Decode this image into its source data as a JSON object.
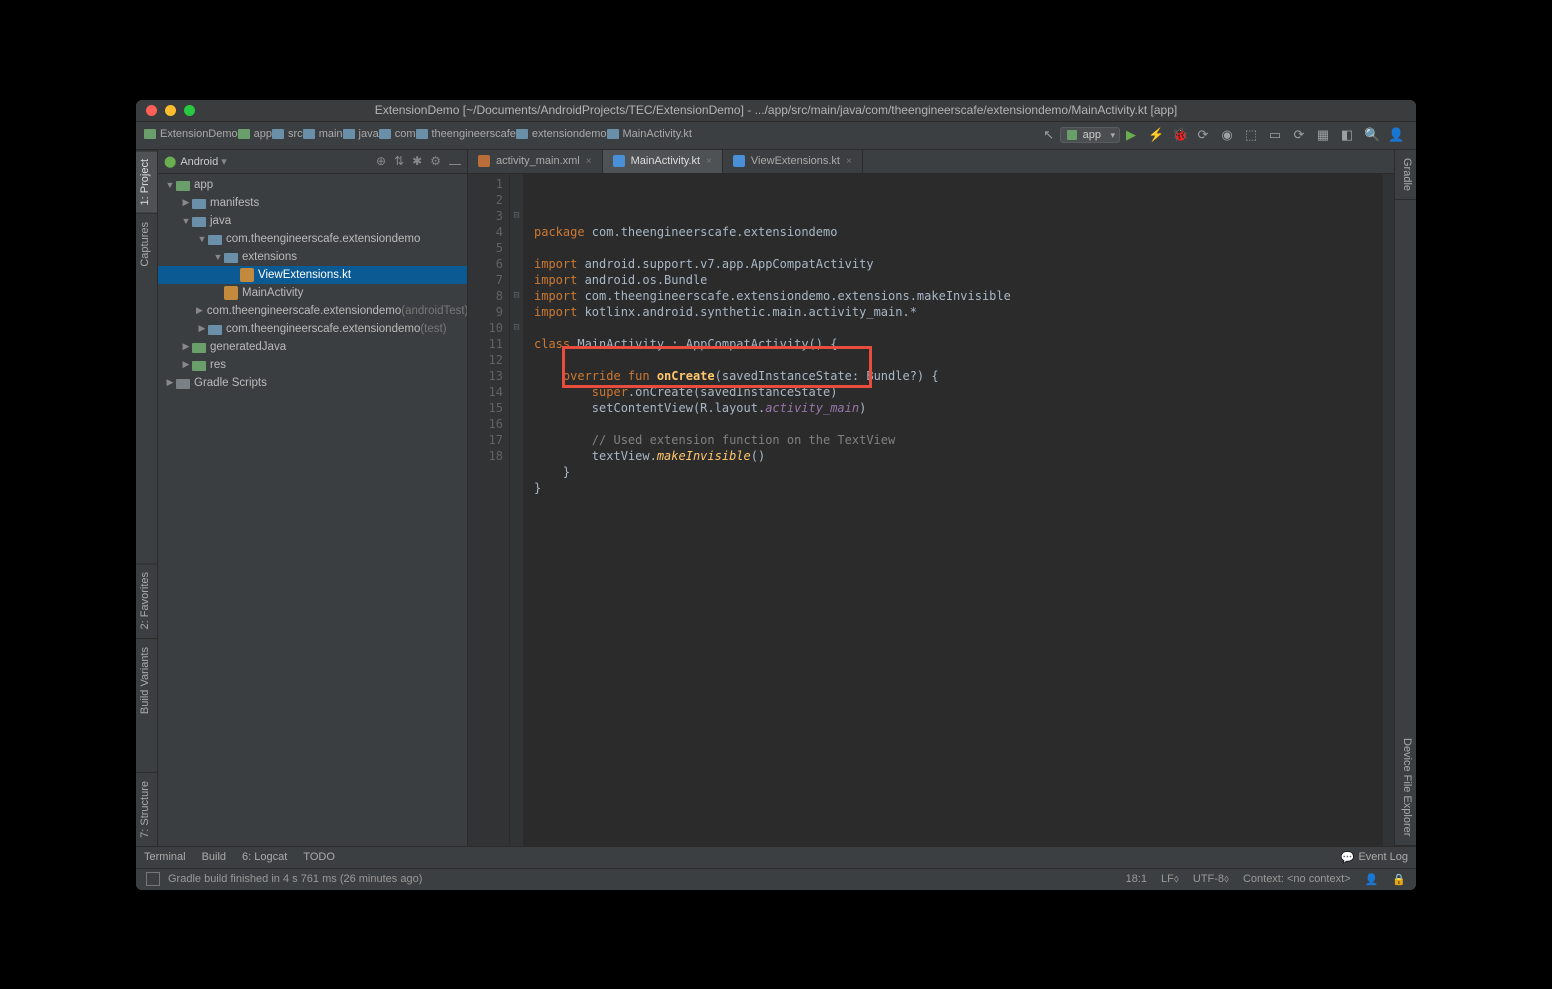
{
  "window_title": "ExtensionDemo [~/Documents/AndroidProjects/TEC/ExtensionDemo] - .../app/src/main/java/com/theengineerscafe/extensiondemo/MainActivity.kt [app]",
  "breadcrumb": [
    "ExtensionDemo",
    "app",
    "src",
    "main",
    "java",
    "com",
    "theengineerscafe",
    "extensiondemo",
    "MainActivity.kt"
  ],
  "run_config": "app",
  "project_panel": {
    "title": "Android",
    "head_icons": [
      "⊕",
      "⇅",
      "✱",
      "⚙",
      "⎼"
    ],
    "tree": [
      {
        "depth": 0,
        "tw": "▼",
        "icon": "folder green",
        "label": "app"
      },
      {
        "depth": 1,
        "tw": "▶",
        "icon": "folder blue",
        "label": "manifests"
      },
      {
        "depth": 1,
        "tw": "▼",
        "icon": "folder blue",
        "label": "java"
      },
      {
        "depth": 2,
        "tw": "▼",
        "icon": "folder blue",
        "label": "com.theengineerscafe.extensiondemo"
      },
      {
        "depth": 3,
        "tw": "▼",
        "icon": "folder blue",
        "label": "extensions"
      },
      {
        "depth": 4,
        "tw": "",
        "icon": "ktfile",
        "label": "ViewExtensions.kt",
        "selected": true
      },
      {
        "depth": 3,
        "tw": "",
        "icon": "ktfile",
        "label": "MainActivity"
      },
      {
        "depth": 2,
        "tw": "▶",
        "icon": "folder blue",
        "label": "com.theengineerscafe.extensiondemo",
        "dim": "(androidTest)"
      },
      {
        "depth": 2,
        "tw": "▶",
        "icon": "folder blue",
        "label": "com.theengineerscafe.extensiondemo",
        "dim": "(test)"
      },
      {
        "depth": 1,
        "tw": "▶",
        "icon": "folder green",
        "label": "generatedJava"
      },
      {
        "depth": 1,
        "tw": "▶",
        "icon": "folder green",
        "label": "res"
      },
      {
        "depth": 0,
        "tw": "▶",
        "icon": "folder",
        "label": "Gradle Scripts"
      }
    ]
  },
  "editor_tabs": [
    {
      "icon": "xml",
      "label": "activity_main.xml",
      "active": false
    },
    {
      "icon": "kt",
      "label": "MainActivity.kt",
      "active": true
    },
    {
      "icon": "kt",
      "label": "ViewExtensions.kt",
      "active": false
    }
  ],
  "code": {
    "lines": 18,
    "l1": {
      "a": "package",
      "b": " com.theengineerscafe.extensiondemo"
    },
    "l3": {
      "a": "import",
      "b": " android.support.v7.app.AppCompatActivity"
    },
    "l4": {
      "a": "import",
      "b": " android.os.Bundle"
    },
    "l5": {
      "a": "import",
      "b": " com.theengineerscafe.extensiondemo.extensions.makeInvisible"
    },
    "l6": {
      "a": "import",
      "b": " kotlinx.android.synthetic.main.activity_main.*"
    },
    "l8": {
      "a": "class",
      "b": " MainActivity : AppCompatActivity() {"
    },
    "l10": {
      "a": "    override fun ",
      "b": "onCreate",
      "c": "(savedInstanceState: Bundle?) {"
    },
    "l11": {
      "a": "        super",
      "b": ".onCreate(savedInstanceState)"
    },
    "l12": {
      "a": "        setContentView(R.layout.",
      "b": "activity_main",
      "c": ")"
    },
    "l14": "        // Used extension function on the TextView",
    "l15": {
      "a": "        textView.",
      "b": "makeInvisible",
      "c": "()"
    },
    "l16": "    }",
    "l17": "}"
  },
  "left_tabs": [
    {
      "label": "1: Project",
      "active": true
    },
    {
      "label": "Captures",
      "active": false
    },
    {
      "label": "2: Favorites",
      "active": false
    },
    {
      "label": "Build Variants",
      "active": false
    },
    {
      "label": "7: Structure",
      "active": false
    }
  ],
  "right_tabs": [
    {
      "label": "Gradle"
    },
    {
      "label": "Device File Explorer"
    }
  ],
  "bottom_tabs": [
    "Terminal",
    "Build",
    "6: Logcat",
    "TODO"
  ],
  "event_log": "Event Log",
  "status_msg": "Gradle build finished in 4 s 761 ms (26 minutes ago)",
  "status_right": {
    "pos": "18:1",
    "le": "LF⬨",
    "enc": "UTF-8⬨",
    "ctx": "Context: <no context>"
  },
  "toolbar_icons_left": "↖",
  "toolbar_icons": [
    "▶",
    "⚡",
    "🐞",
    "⟳",
    "◉",
    "⬚",
    "▭",
    "⟳",
    "▦",
    "◧",
    "🔍",
    "👤"
  ]
}
